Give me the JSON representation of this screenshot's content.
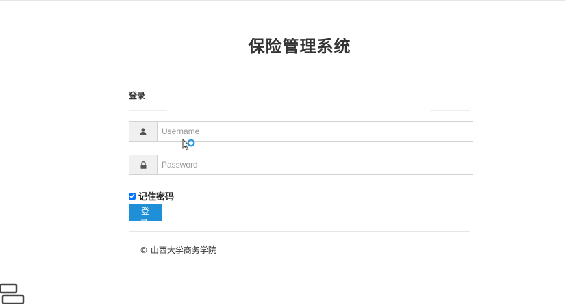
{
  "app": {
    "title": "保险管理系统"
  },
  "login": {
    "heading": "登录",
    "username": {
      "placeholder": "Username",
      "value": "",
      "icon": "user-icon"
    },
    "password": {
      "placeholder": "Password",
      "value": "",
      "icon": "lock-icon"
    },
    "remember": {
      "label": "记住密码",
      "checked": true
    },
    "submit_label": "登 录"
  },
  "footer": {
    "copyright": "© 山西大学商务学院"
  },
  "colors": {
    "accent": "#1f8fd8",
    "border": "#d2d2d2",
    "addon_bg": "#f0f0f0"
  }
}
